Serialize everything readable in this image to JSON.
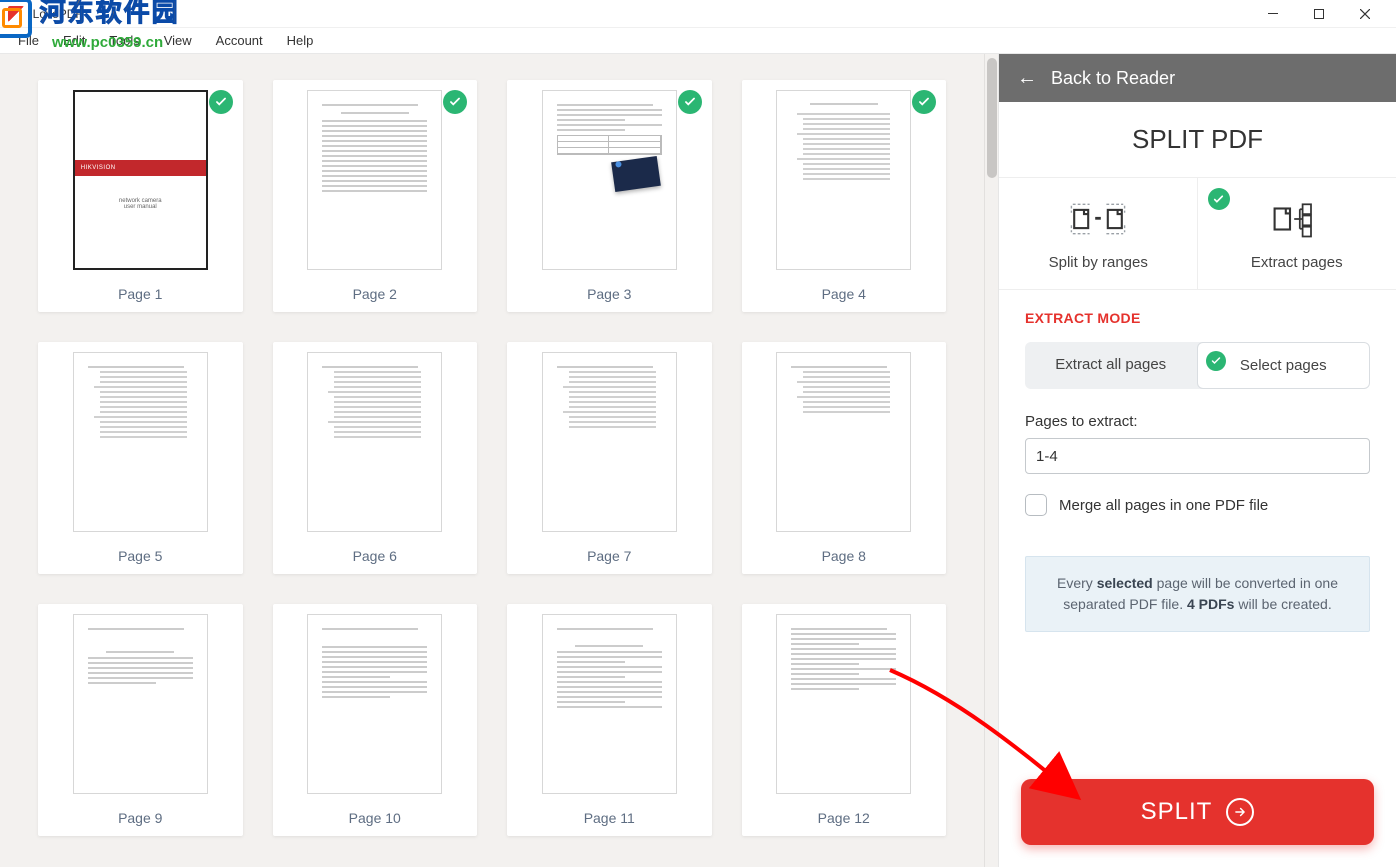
{
  "window": {
    "title": "iLovePDF"
  },
  "menu": {
    "file": "File",
    "edit": "Edit",
    "tools": "Tools",
    "view": "View",
    "account": "Account",
    "help": "Help"
  },
  "thumbs": {
    "pages": [
      {
        "label": "Page 1",
        "selected": true
      },
      {
        "label": "Page 2",
        "selected": true
      },
      {
        "label": "Page 3",
        "selected": true
      },
      {
        "label": "Page 4",
        "selected": true
      },
      {
        "label": "Page 5",
        "selected": false
      },
      {
        "label": "Page 6",
        "selected": false
      },
      {
        "label": "Page 7",
        "selected": false
      },
      {
        "label": "Page 8",
        "selected": false
      },
      {
        "label": "Page 9",
        "selected": false
      },
      {
        "label": "Page 10",
        "selected": false
      },
      {
        "label": "Page 11",
        "selected": false
      },
      {
        "label": "Page 12",
        "selected": false
      }
    ],
    "cover_brand": "HIKVISION"
  },
  "panel": {
    "back_label": "Back to Reader",
    "title": "SPLIT PDF",
    "tab_ranges": "Split by ranges",
    "tab_extract": "Extract pages",
    "section_heading": "EXTRACT MODE",
    "sub_all": "Extract all pages",
    "sub_select": "Select pages",
    "pages_label": "Pages to extract:",
    "pages_value": "1-4",
    "merge_label": "Merge all pages in one PDF file",
    "info_pre": "Every ",
    "info_bold1": "selected",
    "info_mid": " page will be converted in one separated PDF file. ",
    "info_bold2": "4 PDFs",
    "info_post": " will be created.",
    "split_button": "SPLIT"
  },
  "watermark": {
    "text": "河东软件园",
    "url": "www.pc0359.cn"
  }
}
